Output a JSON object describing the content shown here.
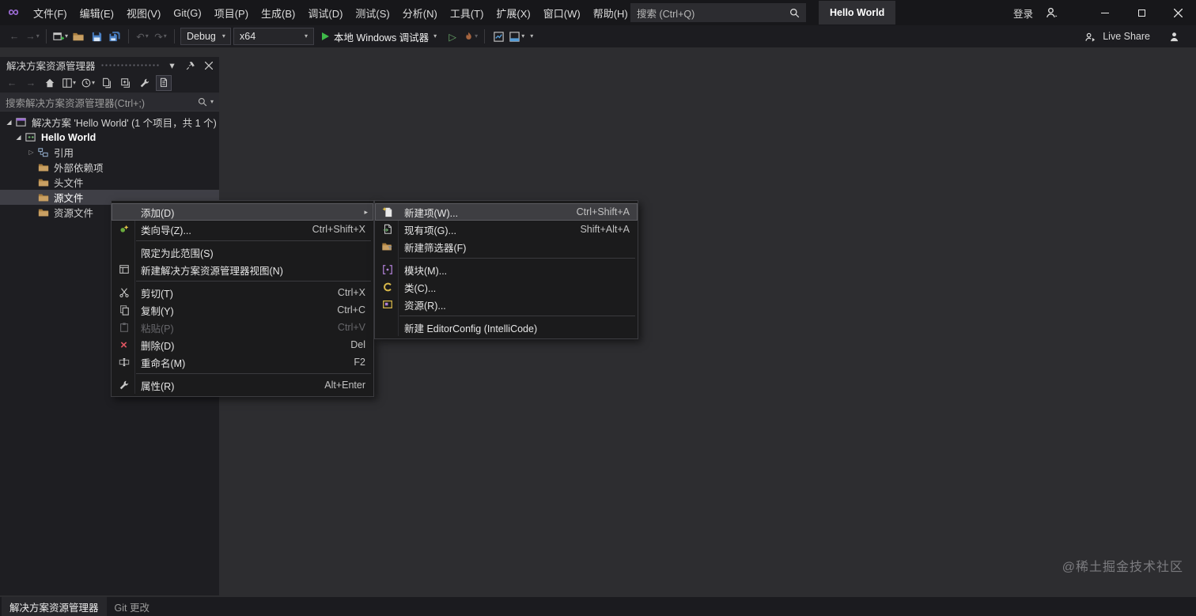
{
  "titlebar": {
    "menus": [
      "文件(F)",
      "编辑(E)",
      "视图(V)",
      "Git(G)",
      "项目(P)",
      "生成(B)",
      "调试(D)",
      "测试(S)",
      "分析(N)",
      "工具(T)",
      "扩展(X)",
      "窗口(W)",
      "帮助(H)"
    ],
    "search_text": "搜索 (Ctrl+Q)",
    "window_title": "Hello World",
    "sign_in": "登录"
  },
  "toolbar": {
    "config": "Debug",
    "platform": "x64",
    "run_label": "本地 Windows 调试器",
    "live_share": "Live Share"
  },
  "panel": {
    "title": "解决方案资源管理器",
    "search_text": "搜索解决方案资源管理器(Ctrl+;)",
    "tree": [
      {
        "label": "解决方案 'Hello World' (1 个项目，共 1 个)"
      },
      {
        "label": "Hello World"
      },
      {
        "label": "引用"
      },
      {
        "label": "外部依赖项"
      },
      {
        "label": "头文件"
      },
      {
        "label": "源文件"
      },
      {
        "label": "资源文件"
      }
    ]
  },
  "context_menu": {
    "items": [
      {
        "label": "添加(D)"
      },
      {
        "label": "类向导(Z)...",
        "shortcut": "Ctrl+Shift+X"
      },
      {
        "label": "限定为此范围(S)"
      },
      {
        "label": "新建解决方案资源管理器视图(N)"
      },
      {
        "label": "剪切(T)",
        "shortcut": "Ctrl+X"
      },
      {
        "label": "复制(Y)",
        "shortcut": "Ctrl+C"
      },
      {
        "label": "粘贴(P)",
        "shortcut": "Ctrl+V"
      },
      {
        "label": "删除(D)",
        "shortcut": "Del"
      },
      {
        "label": "重命名(M)",
        "shortcut": "F2"
      },
      {
        "label": "属性(R)",
        "shortcut": "Alt+Enter"
      }
    ]
  },
  "submenu": {
    "items": [
      {
        "label": "新建项(W)...",
        "shortcut": "Ctrl+Shift+A"
      },
      {
        "label": "现有项(G)...",
        "shortcut": "Shift+Alt+A"
      },
      {
        "label": "新建筛选器(F)"
      },
      {
        "label": "模块(M)..."
      },
      {
        "label": "类(C)..."
      },
      {
        "label": "资源(R)..."
      },
      {
        "label": "新建 EditorConfig (IntelliCode)"
      }
    ]
  },
  "statusbar": {
    "tabs": [
      "解决方案资源管理器",
      "Git 更改"
    ]
  },
  "watermark": "@稀土掘金技术社区",
  "icons": {
    "logo": "∞",
    "chevron_down": "▾",
    "submenu_arrow": "▸",
    "twisty_expanded": "◢",
    "twisty_collapsed": "▷",
    "back_arrow": "←",
    "forward_arrow": "→",
    "undo": "↶",
    "redo": "↷",
    "delete_x": "×",
    "play_outline": "▷"
  },
  "colors": {
    "run_green": "#3fba49",
    "selection_gray": "#3f3f46",
    "menu_bg": "#1b1b1c",
    "folder_yellow": "#c9a063",
    "accent_purple": "#9b6bd3",
    "delete_red": "#e05561"
  }
}
